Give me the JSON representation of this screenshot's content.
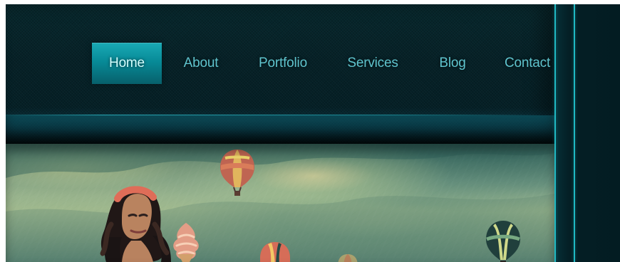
{
  "nav": {
    "items": [
      {
        "label": "Home",
        "active": true
      },
      {
        "label": "About",
        "active": false
      },
      {
        "label": "Portfolio",
        "active": false
      },
      {
        "label": "Services",
        "active": false
      },
      {
        "label": "Blog",
        "active": false
      },
      {
        "label": "Contact",
        "active": false
      }
    ]
  },
  "colors": {
    "background": "#062127",
    "accent": "#1aaab5",
    "nav_text": "#5fc4ce",
    "active_text": "#d4ffff",
    "side_line": "#20b8c2"
  },
  "icons": {
    "hero_balloon_top": "hot-air-balloon-icon",
    "hero_balloon_right": "hot-air-balloon-icon",
    "hero_balloon_bottom": "hot-air-balloon-icon",
    "hero_woman": "woman-portrait-icon",
    "hero_ice_cream": "ice-cream-icon"
  }
}
